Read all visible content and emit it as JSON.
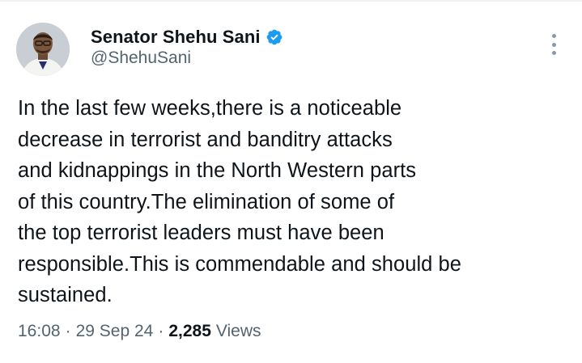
{
  "author": {
    "display_name": "Senator Shehu Sani",
    "handle": "@ShehuSani",
    "verified": true
  },
  "tweet": {
    "text": "In the last few weeks,there is a noticeable\ndecrease in terrorist and banditry attacks\nand kidnappings in the North Western parts\nof this country.The elimination of some of\nthe top terrorist leaders must have been\nresponsible.This is commendable and should be\nsustained."
  },
  "meta": {
    "time": "16:08",
    "separator": "·",
    "date": "29 Sep 24",
    "views_count": "2,285",
    "views_label": "Views"
  },
  "colors": {
    "verified_badge": "#1d9bf0",
    "secondary_text": "#536471",
    "primary_text": "#0f1419"
  },
  "icons": {
    "verified": "verified-badge-icon",
    "more": "more-options-icon"
  }
}
